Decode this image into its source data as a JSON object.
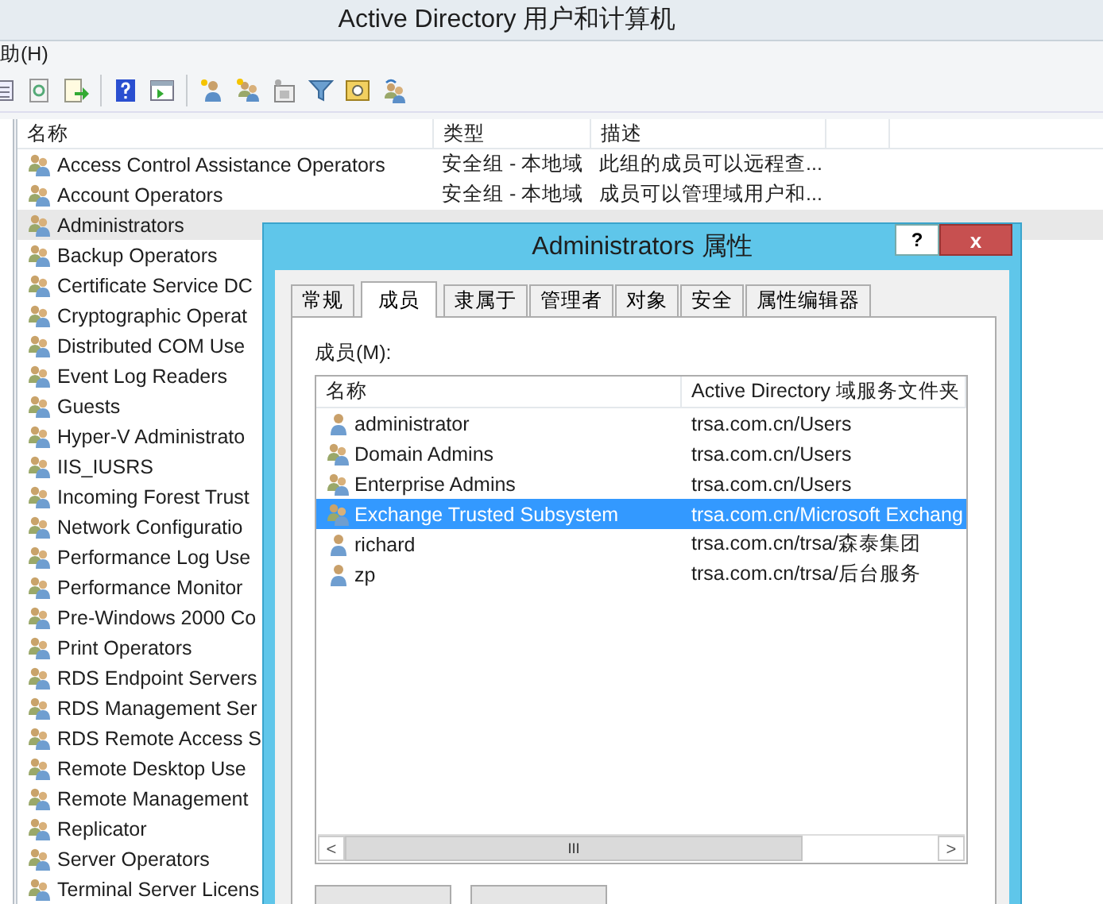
{
  "window": {
    "title": "Active Directory 用户和计算机"
  },
  "menu": [
    "助(H)"
  ],
  "table": {
    "columns": [
      "名称",
      "类型",
      "描述"
    ],
    "rows": [
      {
        "name": "Access Control Assistance Operators",
        "type": "安全组 - 本地域",
        "description": "此组的成员可以远程查...",
        "selected": false
      },
      {
        "name": "Account Operators",
        "type": "安全组 - 本地域",
        "description": "成员可以管理域用户和...",
        "selected": false
      },
      {
        "name": "Administrators",
        "selected": true
      },
      {
        "name": "Backup Operators",
        "selected": false
      },
      {
        "name": "Certificate Service DC",
        "selected": false
      },
      {
        "name": "Cryptographic Operat",
        "selected": false
      },
      {
        "name": "Distributed COM Use",
        "selected": false
      },
      {
        "name": "Event Log Readers",
        "selected": false
      },
      {
        "name": "Guests",
        "selected": false
      },
      {
        "name": "Hyper-V Administrato",
        "selected": false
      },
      {
        "name": "IIS_IUSRS",
        "selected": false
      },
      {
        "name": "Incoming Forest Trust",
        "selected": false
      },
      {
        "name": "Network Configuratio",
        "selected": false
      },
      {
        "name": "Performance Log Use",
        "selected": false
      },
      {
        "name": "Performance Monitor",
        "selected": false
      },
      {
        "name": "Pre-Windows 2000 Co",
        "selected": false
      },
      {
        "name": "Print Operators",
        "selected": false
      },
      {
        "name": "RDS Endpoint Servers",
        "selected": false
      },
      {
        "name": "RDS Management Ser",
        "selected": false
      },
      {
        "name": "RDS Remote Access S",
        "selected": false
      },
      {
        "name": "Remote Desktop Use",
        "selected": false
      },
      {
        "name": "Remote Management",
        "selected": false
      },
      {
        "name": "Replicator",
        "selected": false
      },
      {
        "name": "Server Operators",
        "selected": false
      },
      {
        "name": "Terminal Server Licens",
        "selected": false
      }
    ]
  },
  "dialog": {
    "title": "Administrators 属性",
    "help": "?",
    "close": "x",
    "tabs": [
      {
        "label": "常规",
        "selected": false
      },
      {
        "label": "成员",
        "selected": true
      },
      {
        "label": "隶属于",
        "selected": false
      },
      {
        "label": "管理者",
        "selected": false
      },
      {
        "label": "对象",
        "selected": false
      },
      {
        "label": "安全",
        "selected": false
      },
      {
        "label": "属性编辑器",
        "selected": false
      }
    ],
    "members_label": "成员(M):",
    "columns": [
      "名称",
      "Active Directory 域服务文件夹"
    ],
    "members": [
      {
        "kind": "user",
        "name": "administrator",
        "folder": "trsa.com.cn/Users",
        "selected": false
      },
      {
        "kind": "group",
        "name": "Domain Admins",
        "folder": "trsa.com.cn/Users",
        "selected": false
      },
      {
        "kind": "group",
        "name": "Enterprise Admins",
        "folder": "trsa.com.cn/Users",
        "selected": false
      },
      {
        "kind": "group",
        "name": "Exchange Trusted Subsystem",
        "folder": "trsa.com.cn/Microsoft Exchang",
        "selected": true
      },
      {
        "kind": "user",
        "name": "richard",
        "folder": "trsa.com.cn/trsa/森泰集团",
        "selected": false
      },
      {
        "kind": "user",
        "name": "zp",
        "folder": "trsa.com.cn/trsa/后台服务",
        "selected": false
      }
    ],
    "scroll_grip": "III",
    "scroll_left": "<",
    "scroll_right": ">"
  }
}
